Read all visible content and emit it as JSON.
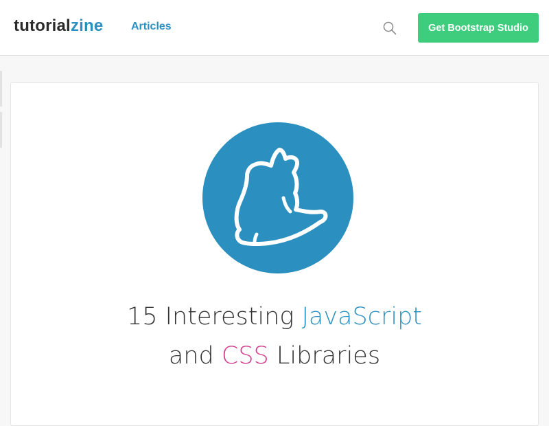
{
  "navbar": {
    "brand_main": "tutorial",
    "brand_accent": "zine",
    "articles_label": "Articles",
    "search_icon": "search-icon",
    "cta_label": "Get Bootstrap Studio"
  },
  "article": {
    "image_icon": "yarn-cat-logo",
    "title_line1_plain": "15 Interesting ",
    "title_line1_highlight": "JavaScript",
    "title_line2_start": "and ",
    "title_line2_highlight": "CSS",
    "title_line2_end": " Libraries"
  },
  "colors": {
    "brand_blue": "#2b90bf",
    "cta_green": "#3dcd7d",
    "highlight_pink": "#d33a8e",
    "text_dark": "#333333"
  }
}
